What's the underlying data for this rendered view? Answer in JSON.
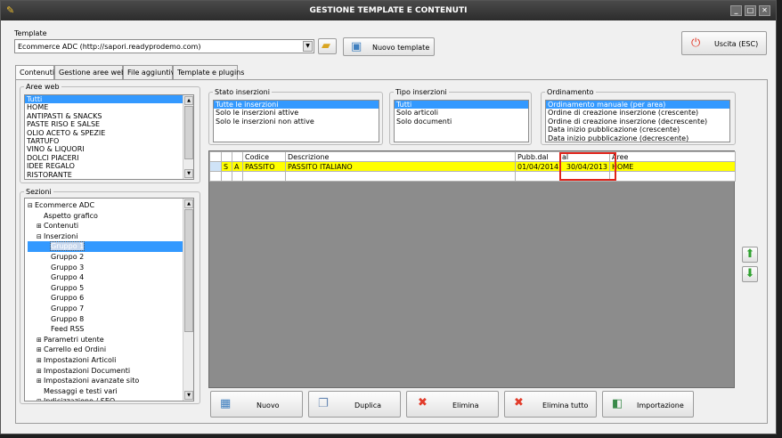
{
  "window": {
    "title": "GESTIONE TEMPLATE E CONTENUTI",
    "min": "_",
    "max": "□",
    "close": "✕"
  },
  "template": {
    "label": "Template",
    "value": "Ecommerce ADC (http://sapori.readyprodemo.com)",
    "new_label": "Nuovo template",
    "exit_label": "Uscita (ESC)"
  },
  "tabs": [
    "Contenuti",
    "Gestione aree web",
    "File aggiuntivi",
    "Template e plugins"
  ],
  "aree_web": {
    "label": "Aree web",
    "items": [
      "Tutti",
      "HOME",
      "ANTIPASTI & SNACKS",
      "PASTE RISO E SALSE",
      "OLIO ACETO & SPEZIE",
      "TARTUFO",
      "VINO & LIQUORI",
      "DOLCI PIACERI",
      "IDEE REGALO",
      "RISTORANTE"
    ]
  },
  "sezioni": {
    "label": "Sezioni",
    "items": [
      {
        "text": "Ecommerce ADC",
        "exp": "⊟"
      },
      {
        "text": "Aspetto grafico",
        "exp": ""
      },
      {
        "text": "Contenuti",
        "exp": "⊞"
      },
      {
        "text": "Inserzioni",
        "exp": "⊟"
      },
      {
        "text": "Gruppo 1",
        "exp": ""
      },
      {
        "text": "Gruppo 2",
        "exp": ""
      },
      {
        "text": "Gruppo 3",
        "exp": ""
      },
      {
        "text": "Gruppo 4",
        "exp": ""
      },
      {
        "text": "Gruppo 5",
        "exp": ""
      },
      {
        "text": "Gruppo 6",
        "exp": ""
      },
      {
        "text": "Gruppo 7",
        "exp": ""
      },
      {
        "text": "Gruppo 8",
        "exp": ""
      },
      {
        "text": "Feed RSS",
        "exp": ""
      },
      {
        "text": "Parametri utente",
        "exp": "⊞"
      },
      {
        "text": "Carrello ed Ordini",
        "exp": "⊞"
      },
      {
        "text": "Impostazioni Articoli",
        "exp": "⊞"
      },
      {
        "text": "Impostazioni Documenti",
        "exp": "⊞"
      },
      {
        "text": "Impostazioni avanzate sito",
        "exp": "⊞"
      },
      {
        "text": "Messaggi e testi vari",
        "exp": ""
      },
      {
        "text": "Indicizzazione / SEO",
        "exp": "⊞"
      }
    ]
  },
  "stato": {
    "label": "Stato inserzioni",
    "items": [
      "Tutte le inserzioni",
      "Solo le inserzioni attive",
      "Solo le inserzioni non attive"
    ]
  },
  "tipo": {
    "label": "Tipo inserzioni",
    "items": [
      "Tutti",
      "Solo articoli",
      "Solo documenti"
    ]
  },
  "ordinamento": {
    "label": "Ordinamento",
    "items": [
      "Ordinamento manuale (per area)",
      "Ordine di creazione inserzione (crescente)",
      "Ordine di creazione inserzione (decrescente)",
      "Data inizio pubblicazione (crescente)",
      "Data inizio pubblicazione (decrescente)"
    ]
  },
  "grid": {
    "headers": [
      "",
      "",
      "",
      "Codice",
      "Descrizione",
      "Pubb.dal",
      "al",
      "Aree"
    ],
    "rows": [
      [
        "",
        "S",
        "A",
        "PASSITO",
        "PASSITO ITALIANO",
        "01/04/2014",
        "30/04/2013",
        "HOME"
      ]
    ]
  },
  "buttons": {
    "nuovo": "Nuovo",
    "duplica": "Duplica",
    "elimina": "Elimina",
    "elimina_tutto": "Elimina tutto",
    "importazione": "Importazione"
  },
  "colors": {
    "highlight_row": "#ffff00",
    "annotation_box": "#e0241b",
    "selection": "#3399ff"
  }
}
